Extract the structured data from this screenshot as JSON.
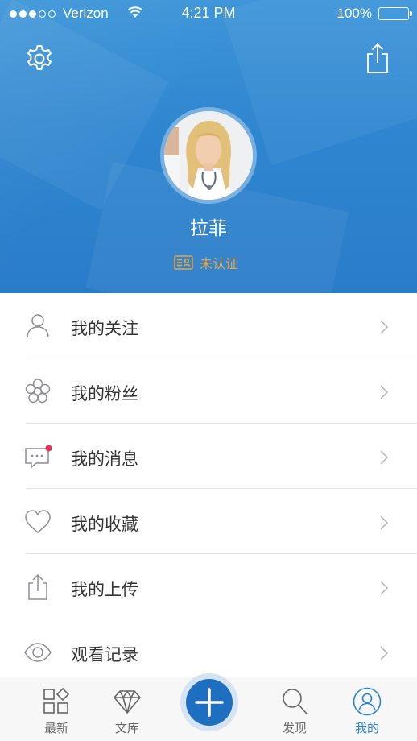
{
  "status_bar": {
    "carrier": "Verizon",
    "time": "4:21 PM",
    "battery": "100%",
    "signal_bars_filled": 3,
    "signal_bars_total": 5
  },
  "header": {
    "settings_icon": "gear-icon",
    "share_icon": "share-icon",
    "user_name": "拉菲",
    "verification_status": "未认证",
    "verification_color": "#f0a43a",
    "background_color": "#2f86d0"
  },
  "menu": {
    "items": [
      {
        "label": "我的关注",
        "icon": "person-icon"
      },
      {
        "label": "我的粉丝",
        "icon": "flower-icon"
      },
      {
        "label": "我的消息",
        "icon": "message-icon",
        "badge_color": "#e8325a"
      },
      {
        "label": "我的收藏",
        "icon": "heart-icon"
      },
      {
        "label": "我的上传",
        "icon": "upload-icon"
      },
      {
        "label": "观看记录",
        "icon": "eye-icon"
      }
    ]
  },
  "tabbar": {
    "accent_color": "#2a84d2",
    "items": [
      {
        "label": "最新",
        "icon": "grid-icon"
      },
      {
        "label": "文库",
        "icon": "diamond-icon"
      },
      {
        "label": "",
        "icon": "plus-icon"
      },
      {
        "label": "发现",
        "icon": "search-icon"
      },
      {
        "label": "我的",
        "icon": "profile-icon",
        "active": true
      }
    ]
  }
}
